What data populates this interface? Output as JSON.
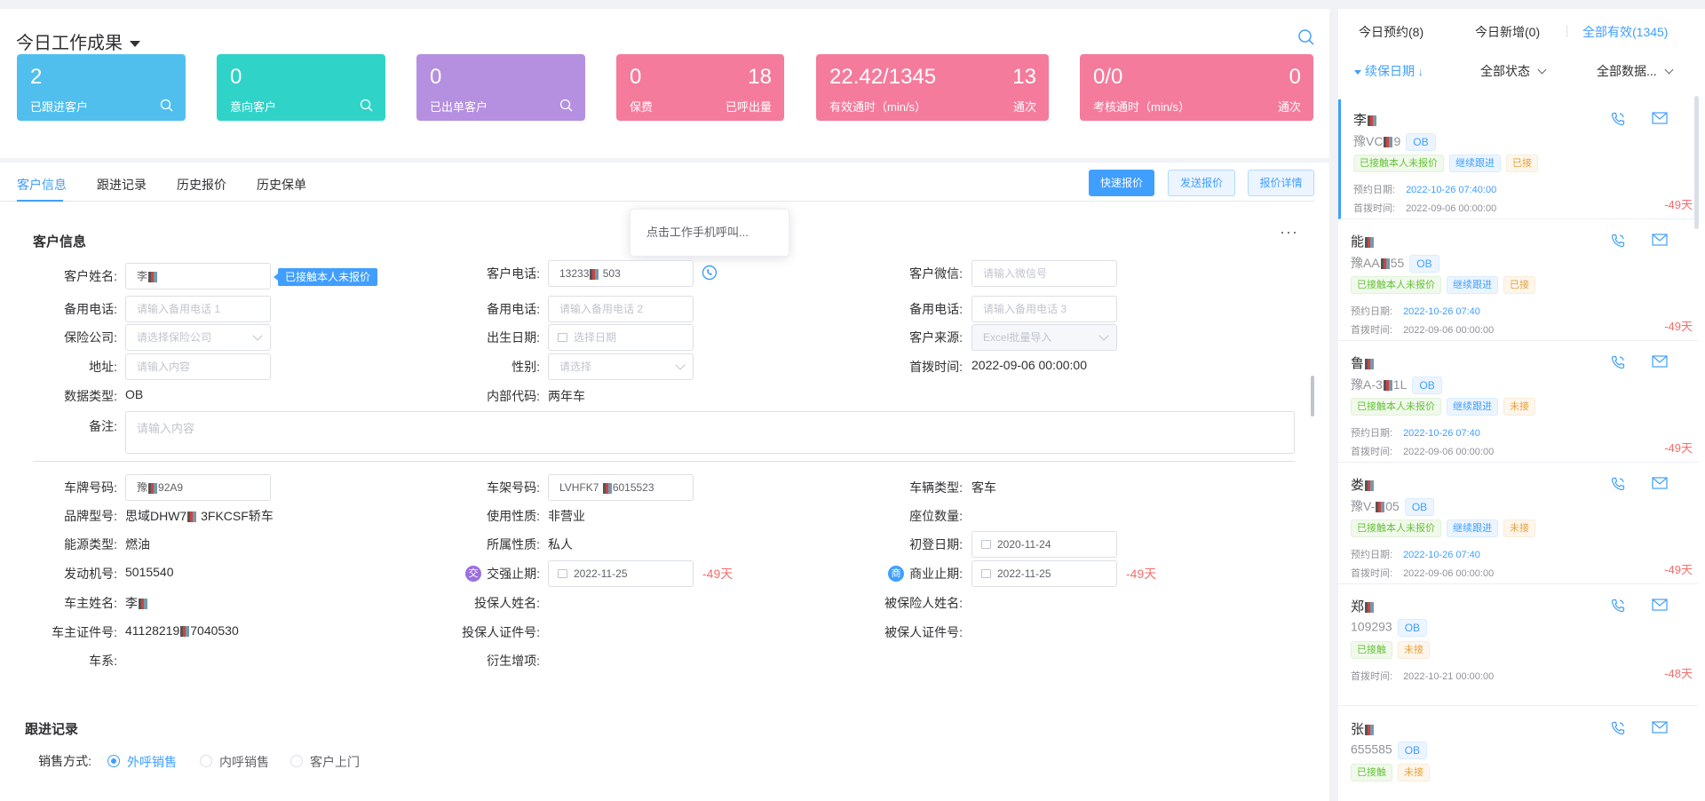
{
  "summary": {
    "title": "今日工作成果",
    "cards": [
      {
        "value": "2",
        "label": "已跟进客户",
        "color": "#50bfee"
      },
      {
        "value": "0",
        "label": "意向客户",
        "color": "#30d3c8"
      },
      {
        "value": "0",
        "label": "已出单客户",
        "color": "#b58fe0"
      },
      {
        "value": "0",
        "label": "保费",
        "value2": "18",
        "label2": "已呼出量",
        "color": "#f47b9c"
      },
      {
        "value": "22.42/1345",
        "label": "有效通时（min/s）",
        "value2": "13",
        "label2": "通次",
        "color": "#f47b9c"
      },
      {
        "value": "0/0",
        "label": "考核通时（min/s）",
        "value2": "0",
        "label2": "通次",
        "color": "#f47b9c"
      }
    ]
  },
  "tabs": [
    "客户信息",
    "跟进记录",
    "历史报价",
    "历史保单"
  ],
  "actions": {
    "quick_quote": "快速报价",
    "send_quote": "发送报价",
    "quote_detail": "报价详情"
  },
  "popover": "点击工作手机呼叫...",
  "customer": {
    "section_title": "客户信息",
    "more": "···",
    "name_label": "客户姓名:",
    "name_value": "李",
    "status_tag": "已接触本人未报价",
    "phone_label": "客户电话:",
    "phone_value_a": "13233",
    "phone_value_b": "503",
    "wechat_label": "客户微信:",
    "wechat_placeholder": "请输入微信号",
    "alt_phone_label": "备用电话:",
    "alt_phone1_placeholder": "请输入备用电话 1",
    "alt_phone2_placeholder": "请输入备用电话 2",
    "alt_phone3_placeholder": "请输入备用电话 3",
    "insurer_label": "保险公司:",
    "insurer_placeholder": "请选择保险公司",
    "birth_label": "出生日期:",
    "birth_placeholder": "选择日期",
    "source_label": "客户来源:",
    "source_value": "Excel批量导入",
    "address_label": "地址:",
    "address_placeholder": "请输入内容",
    "gender_label": "性别:",
    "gender_placeholder": "请选择",
    "first_dial_label": "首拨时间:",
    "first_dial_value": "2022-09-06 00:00:00",
    "data_type_label": "数据类型:",
    "data_type_value": "OB",
    "internal_code_label": "内部代码:",
    "internal_code_value": "两年车",
    "remark_label": "备注:",
    "remark_placeholder": "请输入内容"
  },
  "vehicle": {
    "plate_label": "车牌号码:",
    "plate_value_a": "豫",
    "plate_value_b": "92A9",
    "vin_label": "车架号码:",
    "vin_value_a": "LVHFK7",
    "vin_value_b": "6015523",
    "vtype_label": "车辆类型:",
    "vtype_value": "客车",
    "brand_label": "品牌型号:",
    "brand_value_a": "思域DHW7",
    "brand_value_b": "3FKCSF轿车",
    "usage_label": "使用性质:",
    "usage_value": "非营业",
    "seats_label": "座位数量:",
    "energy_label": "能源类型:",
    "energy_value": "燃油",
    "owner_type_label": "所属性质:",
    "owner_type_value": "私人",
    "reg_date_label": "初登日期:",
    "reg_date_value": "2020-11-24",
    "engine_label": "发动机号:",
    "engine_value": "5015540",
    "ci_badge": "交",
    "ci_label": "交强止期:",
    "ci_value": "2022-11-25",
    "ci_days": "-49天",
    "bi_badge": "商",
    "bi_label": "商业止期:",
    "bi_value": "2022-11-25",
    "bi_days": "-49天",
    "owner_label": "车主姓名:",
    "owner_value": "李",
    "holder_label": "投保人姓名:",
    "insured_label": "被保险人姓名:",
    "owner_id_label": "车主证件号:",
    "owner_id_value_a": "41128219",
    "owner_id_value_b": "7040530",
    "holder_id_label": "投保人证件号:",
    "insured_id_label": "被保人证件号:",
    "series_label": "车系:",
    "derive_label": "衍生增项:"
  },
  "followup": {
    "section_title": "跟进记录",
    "sale_method_label": "销售方式:",
    "options": [
      "外呼销售",
      "内呼销售",
      "客户上门"
    ]
  },
  "right": {
    "tabs": [
      "今日预约(8)",
      "今日新增(0)",
      "全部有效(1345)"
    ],
    "filters": [
      "续保日期",
      "全部状态",
      "全部数据..."
    ],
    "labels": {
      "appointment": "预约日期:",
      "first_dial": "首拨时间:"
    },
    "customers": [
      {
        "name": "李",
        "plate": "豫VC",
        "plate2": "9",
        "type": "OB",
        "tags": [
          [
            "已接触本人未报价",
            "green"
          ],
          [
            "继续跟进",
            "blue"
          ],
          [
            "已接",
            "orange"
          ]
        ],
        "appointment": "2022-10-26 07:40:00",
        "first_dial": "2022-09-06 00:00:00",
        "days": "-49天"
      },
      {
        "name": "能",
        "plate": "豫AA",
        "plate2": "55",
        "type": "OB",
        "tags": [
          [
            "已接触本人未报价",
            "green"
          ],
          [
            "继续跟进",
            "blue"
          ],
          [
            "已接",
            "orange"
          ]
        ],
        "appointment": "2022-10-26 07:40",
        "first_dial": "2022-09-06 00:00:00",
        "days": "-49天"
      },
      {
        "name": "鲁",
        "plate": "豫A-3",
        "plate2": "1L",
        "type": "OB",
        "tags": [
          [
            "已接触本人未报价",
            "green"
          ],
          [
            "继续跟进",
            "blue"
          ],
          [
            "未接",
            "orange"
          ]
        ],
        "appointment": "2022-10-26 07:40",
        "first_dial": "2022-09-06 00:00:00",
        "days": "-49天"
      },
      {
        "name": "娄",
        "plate": "豫V-",
        "plate2": "05",
        "type": "OB",
        "tags": [
          [
            "已接触本人未报价",
            "green"
          ],
          [
            "继续跟进",
            "blue"
          ],
          [
            "未接",
            "orange"
          ]
        ],
        "appointment": "2022-10-26 07:40",
        "first_dial": "2022-09-06 00:00:00",
        "days": "-49天"
      },
      {
        "name": "郑",
        "plate": "109293",
        "plate2": "",
        "type": "OB",
        "tags": [
          [
            "已接触",
            "green"
          ],
          [
            "未接",
            "orange"
          ]
        ],
        "appointment": "",
        "first_dial": "2022-10-21 00:00:00",
        "days": "-48天"
      },
      {
        "name": "张",
        "plate": "655585",
        "plate2": "",
        "type": "OB",
        "tags": [
          [
            "已接触",
            "green"
          ],
          [
            "未接",
            "orange"
          ]
        ],
        "appointment": "",
        "first_dial": "",
        "days": ""
      }
    ]
  }
}
